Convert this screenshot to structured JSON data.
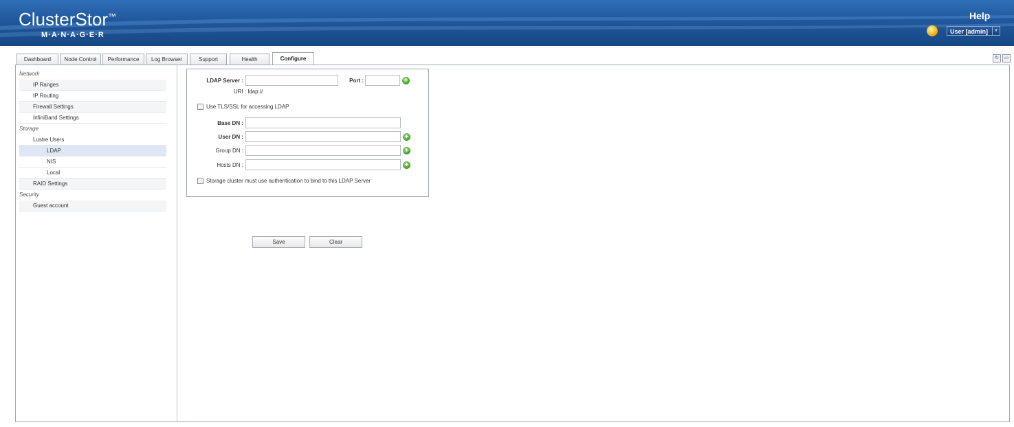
{
  "header": {
    "logo_text": "ClusterStor",
    "logo_tm": "™",
    "logo_subtitle": "M·A·N·A·G·E·R",
    "help_label": "Help",
    "user_menu_label": "User [admin]",
    "user_menu_caret": "▼"
  },
  "tabs": [
    {
      "label": "Dashboard"
    },
    {
      "label": "Node Control"
    },
    {
      "label": "Performance"
    },
    {
      "label": "Log Browser"
    },
    {
      "label": "Support"
    },
    {
      "label": "Health"
    },
    {
      "label": "Configure",
      "active": true
    }
  ],
  "corner_icons": {
    "refresh": "↻",
    "window": "▭"
  },
  "sidebar": {
    "items": [
      {
        "label": "Network",
        "type": "category"
      },
      {
        "label": "IP Ranges",
        "level": 1
      },
      {
        "label": "IP Routing",
        "level": 1
      },
      {
        "label": "Firewall Settings",
        "level": 1
      },
      {
        "label": "InfiniBand Settings",
        "level": 1
      },
      {
        "label": "Storage",
        "type": "category"
      },
      {
        "label": "Lustre Users",
        "level": 1
      },
      {
        "label": "LDAP",
        "level": 2,
        "selected": true
      },
      {
        "label": "NIS",
        "level": 2
      },
      {
        "label": "Local",
        "level": 2
      },
      {
        "label": "RAID Settings",
        "level": 1
      },
      {
        "label": "Security",
        "type": "category"
      },
      {
        "label": "Guest account",
        "level": 1
      }
    ]
  },
  "form": {
    "ldap_server_label": "LDAP Server :",
    "ldap_server_value": "",
    "port_label": "Port :",
    "port_value": "",
    "uri_text": "URI : ldap://",
    "tls_label": "Use TLS/SSL for accessing LDAP",
    "tls_checked": false,
    "base_dn_label": "Base DN :",
    "base_dn_value": "",
    "user_dn_label": "User DN :",
    "user_dn_value": "",
    "group_dn_label": "Group DN :",
    "group_dn_value": "",
    "hosts_dn_label": "Hosts DN :",
    "hosts_dn_value": "",
    "auth_label": "Storage cluster must use authentication to bind to this LDAP Server",
    "auth_checked": false,
    "add_icon_glyph": "+"
  },
  "actions": {
    "save_label": "Save",
    "clear_label": "Clear"
  },
  "colors": {
    "header_top": "#2e6fb8",
    "header_bottom": "#174784",
    "selected_row": "#dfe7f5",
    "add_icon": "#4aa82d",
    "status_orb": "#f5c12b"
  }
}
